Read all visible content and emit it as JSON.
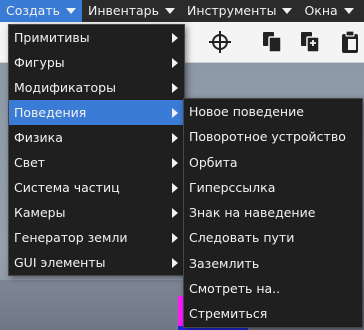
{
  "menubar": {
    "items": [
      {
        "label": "Создать",
        "active": true
      },
      {
        "label": "Инвентарь",
        "active": false
      },
      {
        "label": "Инструменты",
        "active": false
      },
      {
        "label": "Окна",
        "active": false
      }
    ]
  },
  "toolbar": {
    "icons": [
      "move-tool-icon",
      "crosshair-icon",
      "copy-icon",
      "paste-duplicate-icon",
      "clipboard-icon"
    ]
  },
  "create_menu": {
    "items": [
      {
        "label": "Примитивы",
        "has_submenu": true
      },
      {
        "label": "Фигуры",
        "has_submenu": true
      },
      {
        "label": "Модификаторы",
        "has_submenu": true
      },
      {
        "label": "Поведения",
        "has_submenu": true,
        "highlighted": true
      },
      {
        "label": "Физика",
        "has_submenu": true
      },
      {
        "label": "Свет",
        "has_submenu": true
      },
      {
        "label": "Система частиц",
        "has_submenu": true
      },
      {
        "label": "Камеры",
        "has_submenu": true
      },
      {
        "label": "Генератор земли",
        "has_submenu": true
      },
      {
        "label": "GUI элементы",
        "has_submenu": true
      }
    ]
  },
  "behaviors_submenu": {
    "items": [
      {
        "label": "Новое поведение"
      },
      {
        "label": "Поворотное устройство"
      },
      {
        "label": "Орбита"
      },
      {
        "label": "Гиперссылка"
      },
      {
        "label": "Знак на наведение"
      },
      {
        "label": "Следовать пути"
      },
      {
        "label": "Заземлить"
      },
      {
        "label": "Смотреть на.."
      },
      {
        "label": "Стремиться"
      }
    ]
  },
  "colors": {
    "menubar_bg": "#2b2b2b",
    "menu_bg": "#1f1f1f",
    "highlight": "#3a7bd5",
    "text": "#f2f2f2",
    "toolbar_bg": "#f4f4f4",
    "scene_accent_pink": "#ff1aff",
    "scene_accent_blue": "#1c27d8"
  }
}
